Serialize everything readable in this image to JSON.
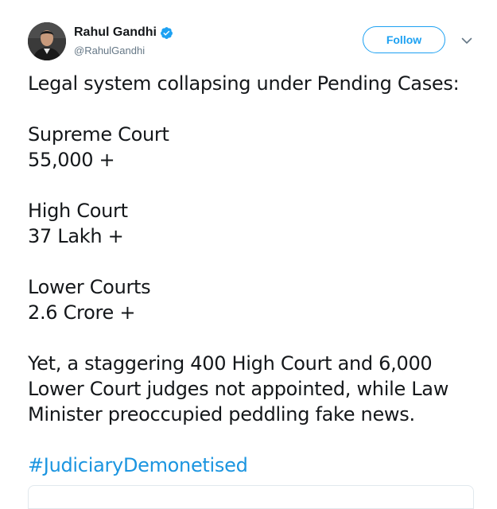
{
  "author": {
    "name": "Rahul Gandhi",
    "handle": "@RahulGandhi",
    "verified": true,
    "avatar_icon": "profile-photo"
  },
  "actions": {
    "follow_label": "Follow",
    "more_icon": "chevron-down-icon"
  },
  "colors": {
    "accent": "#1da1f2",
    "hashtag": "#1b95e0",
    "text": "#14171a",
    "secondary": "#657786"
  },
  "tweet": {
    "intro": "Legal system collapsing under Pending Cases:",
    "items": [
      {
        "court": "Supreme Court",
        "count": "55,000 +"
      },
      {
        "court": "High Court",
        "count": "37 Lakh +"
      },
      {
        "court": "Lower Courts",
        "count": "2.6 Crore +"
      }
    ],
    "closing_lines": [
      "Yet, a staggering 400 High Court and 6,000",
      "Lower Court judges not appointed, while Law",
      "Minister preoccupied peddling fake news."
    ],
    "hashtag": "#JudiciaryDemonetised"
  }
}
